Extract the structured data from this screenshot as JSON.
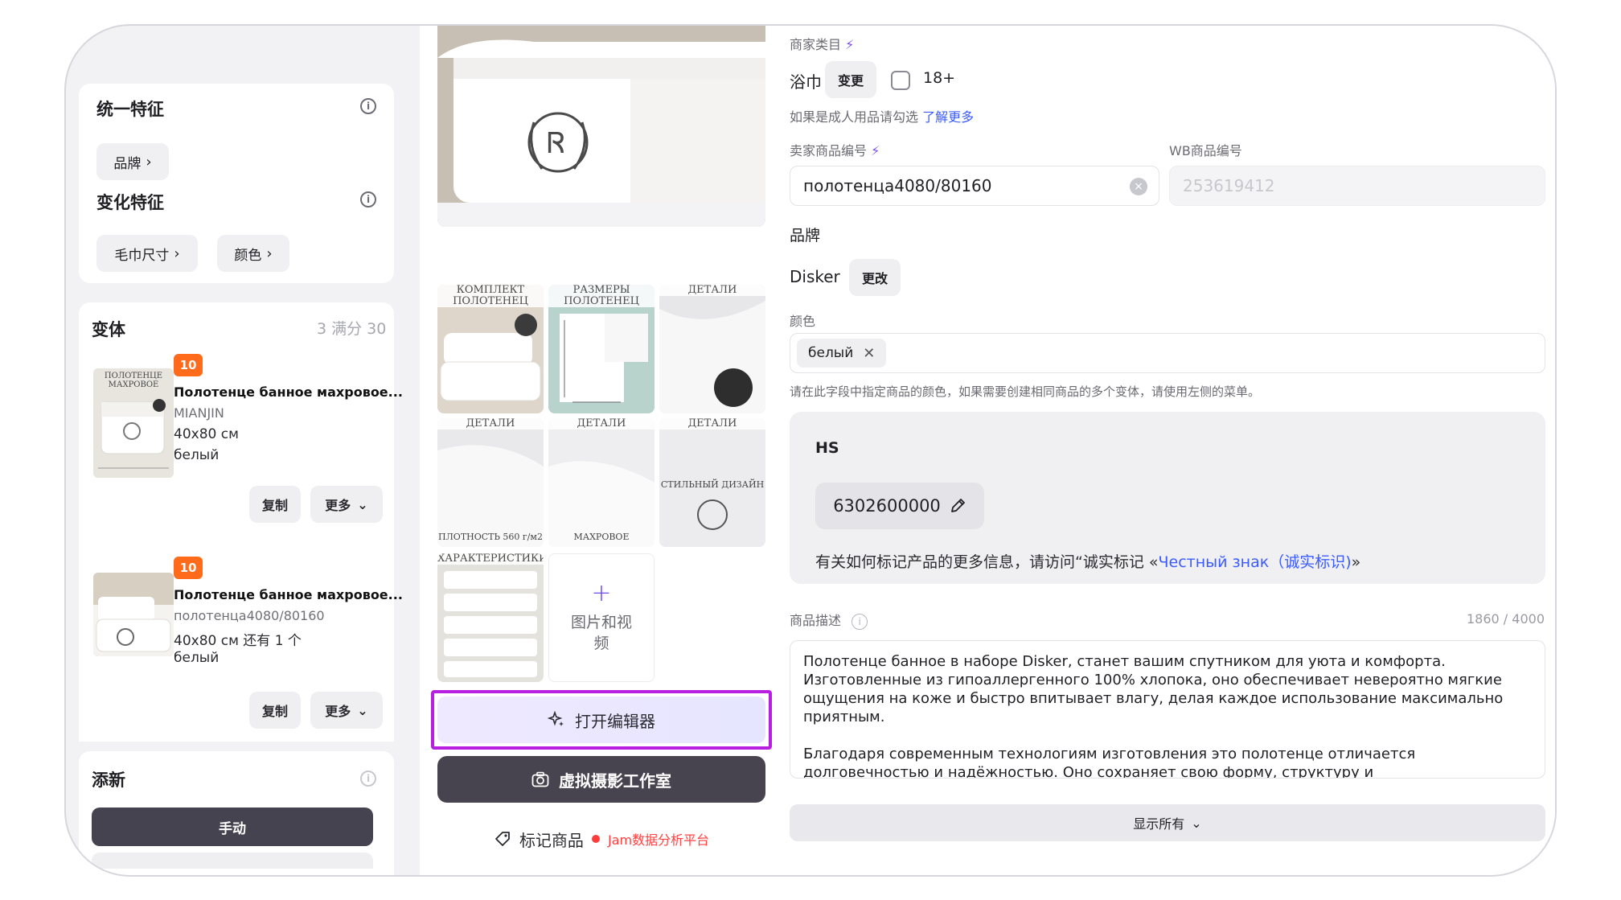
{
  "features": {
    "unified_title": "统一特征",
    "brand_chip": "品牌",
    "variable_title": "变化特征",
    "size_chip": "毛巾尺寸",
    "color_chip": "颜色"
  },
  "variants": {
    "title": "变体",
    "score": "3 满分 30",
    "items": [
      {
        "badge": "10",
        "title": "Полотенце банное махровое...",
        "line1": "MIANJIN",
        "line2": "40x80 см",
        "line3": "белый",
        "thumb_caption": "ПОЛОТЕНЦЕ МАХРОВОЕ",
        "copy": "复制",
        "more": "更多"
      },
      {
        "badge": "10",
        "title": "Полотенце банное махровое...",
        "line1": "полотенца4080/80160",
        "line2": "40x80 см 还有 1 个",
        "line3": "белый",
        "copy": "复制",
        "more": "更多"
      }
    ]
  },
  "add_new": {
    "title": "添新",
    "manual_button": "手动"
  },
  "media": {
    "thumb_captions": [
      "КОМПЛЕКТ ПОЛОТЕНЕЦ",
      "РАЗМЕРЫ ПОЛОТЕНЕЦ",
      "ДЕТАЛИ",
      "ДЕТАЛИ",
      "ДЕТАЛИ",
      "ДЕТАЛИ",
      "ХАРАКТЕРИСТИКИ"
    ],
    "thumb_subcaptions": [
      "",
      "",
      "",
      "ПЛОТНОСТЬ 560 г/м2",
      "МАХРОВОЕ",
      "СТИЛЬНЫЙ ДИЗАЙН",
      ""
    ],
    "add_label": "图片和视频",
    "editor_button": "打开编辑器",
    "studio_button": "虚拟摄影工作室",
    "mark_button": "标记商品",
    "jam_label": "Jam数据分析平台"
  },
  "details": {
    "category_label": "商家类目",
    "category_value": "浴巾",
    "change_button": "变更",
    "adult_label": "18+",
    "adult_hint": "如果是成人用品请勾选",
    "learn_more": "了解更多",
    "seller_sku_label": "卖家商品编号",
    "seller_sku_value": "полотенца4080/80160",
    "wb_sku_label": "WB商品编号",
    "wb_sku_value": "253619412",
    "brand_label": "品牌",
    "brand_value": "Disker",
    "brand_change_button": "更改",
    "color_label": "颜色",
    "color_tag": "белый",
    "color_hint": "请在此字段中指定商品的颜色，如果需要创建相同商品的多个变体，请使用左侧的菜单。",
    "hs_label": "HS",
    "hs_value": "6302600000",
    "hs_info_prefix": "有关如何标记产品的更多信息，请访问“诚实标记 «",
    "hs_info_link": "Честный знак（诚实标识)",
    "hs_info_suffix": "»",
    "desc_label": "商品描述",
    "desc_counter": "1860 / 4000",
    "desc_text": "Полотенце банное в наборе Disker, станет вашим спутником для уюта и комфорта. Изготовленные из гипоаллергенного 100% хлопока, оно обеспечивает невероятно мягкие ощущения на коже и быстро впитывает влагу, делая каждое использование максимально приятным.\n\nБлагодаря современным технологиям изготовления это полотенце отличается долговечностью и надёжностью. Оно сохраняет свою форму, структуру и",
    "show_all": "显示所有"
  },
  "icons": {
    "info": "info-icon",
    "chevron_right": "chevron-right-icon",
    "chevron_down": "chevron-down-icon",
    "sparkle": "sparkle-icon",
    "camera": "camera-icon",
    "tag": "tag-icon",
    "bolt": "bolt-icon",
    "pencil": "pencil-icon",
    "clear": "clear-icon",
    "close": "close-icon",
    "plus": "plus-icon"
  },
  "colors": {
    "accent": "#7a4cf0",
    "highlight_border": "#b81fe0",
    "badge_orange": "#ff6b1a",
    "dark_button": "#45434f",
    "link_blue": "#3b5bff"
  }
}
